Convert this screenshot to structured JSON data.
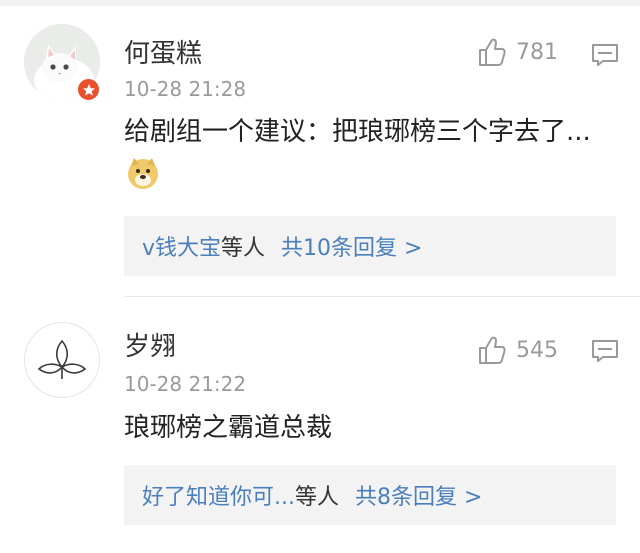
{
  "comments": [
    {
      "username": "何蛋糕",
      "time": "10-28 21:28",
      "likes": "781",
      "content": "给剧组一个建议：把琅琊榜三个字去了...",
      "avatar": "white-cat-icon",
      "badge": "star-badge-icon",
      "replies": {
        "names": "v钱大宝",
        "others": "等人",
        "total": "共10条回复 >"
      }
    },
    {
      "username": "岁翙",
      "time": "10-28 21:22",
      "likes": "545",
      "content": "琅琊榜之霸道总裁",
      "avatar": "leaf-icon",
      "replies": {
        "names": "好了知道你可...",
        "others": "等人",
        "total": "共8条回复 >"
      }
    }
  ],
  "colors": {
    "link": "#4a7fbd",
    "meta": "#9a9a9a",
    "badge": "#e8512b",
    "reply_bg": "#f3f3f3"
  }
}
